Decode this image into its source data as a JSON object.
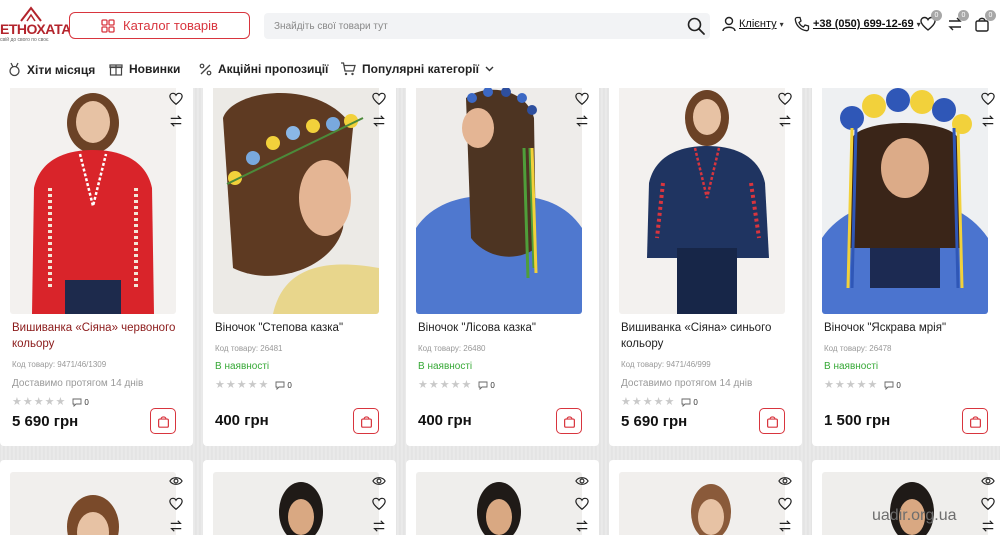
{
  "header": {
    "logo_text": "ЕТНОХАТА",
    "logo_tagline": "свій до свого по своє",
    "catalog_button": "Каталог товарів",
    "search_placeholder": "Знайдіть свої товари тут",
    "user_label": "Клієнту",
    "phone": "+38 (050) 699-12-69",
    "wishlist_count": "0",
    "compare_count": "0",
    "cart_count": "0",
    "accent_color": "#d8353e"
  },
  "nav": {
    "items": [
      {
        "label": "Хіти місяця",
        "icon": "medal-icon"
      },
      {
        "label": "Новинки",
        "icon": "gift-icon"
      },
      {
        "label": "Акційні пропозиції",
        "icon": "percent-icon"
      },
      {
        "label": "Популярні категорії",
        "icon": "cart-icon"
      }
    ]
  },
  "products": [
    {
      "title": "Вишиванка «Сіяна» червоного кольору",
      "sku": "Код товару: 9471/46/1309",
      "availability": "Доставимо протягом 14 днів",
      "availability_status": "delivery",
      "rating": 0,
      "reviews": "0",
      "price": "5 690 грн"
    },
    {
      "title": "Віночок \"Степова казка\"",
      "sku": "Код товару: 26481",
      "availability": "В наявності",
      "availability_status": "in-stock",
      "rating": 0,
      "reviews": "0",
      "price": "400 грн"
    },
    {
      "title": "Віночок \"Лісова казка\"",
      "sku": "Код товару: 26480",
      "availability": "В наявності",
      "availability_status": "in-stock",
      "rating": 0,
      "reviews": "0",
      "price": "400 грн"
    },
    {
      "title": "Вишиванка «Сіяна» синього кольору",
      "sku": "Код товару: 9471/46/999",
      "availability": "Доставимо протягом 14 днів",
      "availability_status": "delivery",
      "rating": 0,
      "reviews": "0",
      "price": "5 690 грн"
    },
    {
      "title": "Віночок \"Яскрава мрія\"",
      "sku": "Код товару: 26478",
      "availability": "В наявності",
      "availability_status": "in-stock",
      "rating": 0,
      "reviews": "0",
      "price": "1 500 грн"
    }
  ],
  "watermark": "uadir.org.ua"
}
